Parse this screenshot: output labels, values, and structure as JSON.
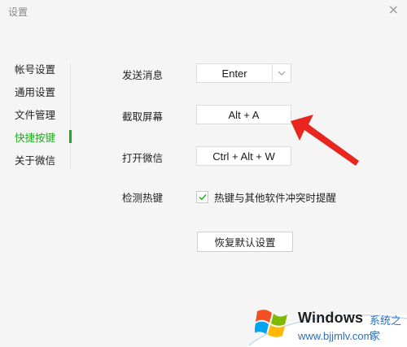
{
  "window": {
    "title": "设置",
    "close_glyph": "×"
  },
  "sidebar": {
    "items": [
      {
        "label": "帐号设置",
        "active": false
      },
      {
        "label": "通用设置",
        "active": false
      },
      {
        "label": "文件管理",
        "active": false
      },
      {
        "label": "快捷按键",
        "active": true
      },
      {
        "label": "关于微信",
        "active": false
      }
    ],
    "accent_color": "#1aad19"
  },
  "shortcuts": {
    "send_message": {
      "label": "发送消息",
      "value": "Enter"
    },
    "screenshot": {
      "label": "截取屏幕",
      "value": "Alt + A"
    },
    "open_wechat": {
      "label": "打开微信",
      "value": "Ctrl + Alt + W"
    },
    "detect_hotkey": {
      "label": "检测热键",
      "checkbox_label": "热键与其他软件冲突时提醒",
      "checked": true
    },
    "restore_label": "恢复默认设置"
  },
  "annotation": {
    "arrow_color": "#e8261f"
  },
  "watermark": {
    "title": "Windows",
    "subtitle_cn": "系统之家",
    "url": "www.bjjmlv.com"
  }
}
